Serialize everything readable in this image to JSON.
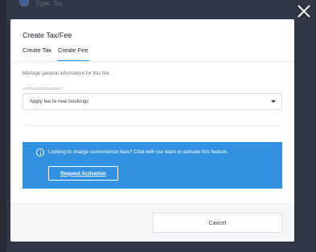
{
  "background": {
    "row_text": "Type: Tax",
    "columns": [
      "-",
      "-",
      "-",
      "-",
      "-"
    ]
  },
  "modal": {
    "title": "Create Tax/Fee",
    "tabs": [
      {
        "label": "Create Tax",
        "active": false
      },
      {
        "label": "Create Fee",
        "active": true
      }
    ],
    "intro": "Manage general information for this fee.",
    "activation_rules": {
      "label": "ACTIVATION RULES",
      "required_mark": "*",
      "value": "Apply fee to new bookings"
    },
    "info_banner": {
      "text": "Looking to charge convenience fees? Chat with our team to activate this feature.",
      "button_label": "Request Activation"
    },
    "footer": {
      "cancel_label": "Cancel"
    }
  },
  "colors": {
    "accent": "#3391e1",
    "tab_underline": "#2f8fd8",
    "required": "#e0413a",
    "overlay": "#2f3542"
  },
  "icons": {
    "close": "close-icon",
    "info": "info-icon",
    "caret": "chevron-down-icon"
  }
}
